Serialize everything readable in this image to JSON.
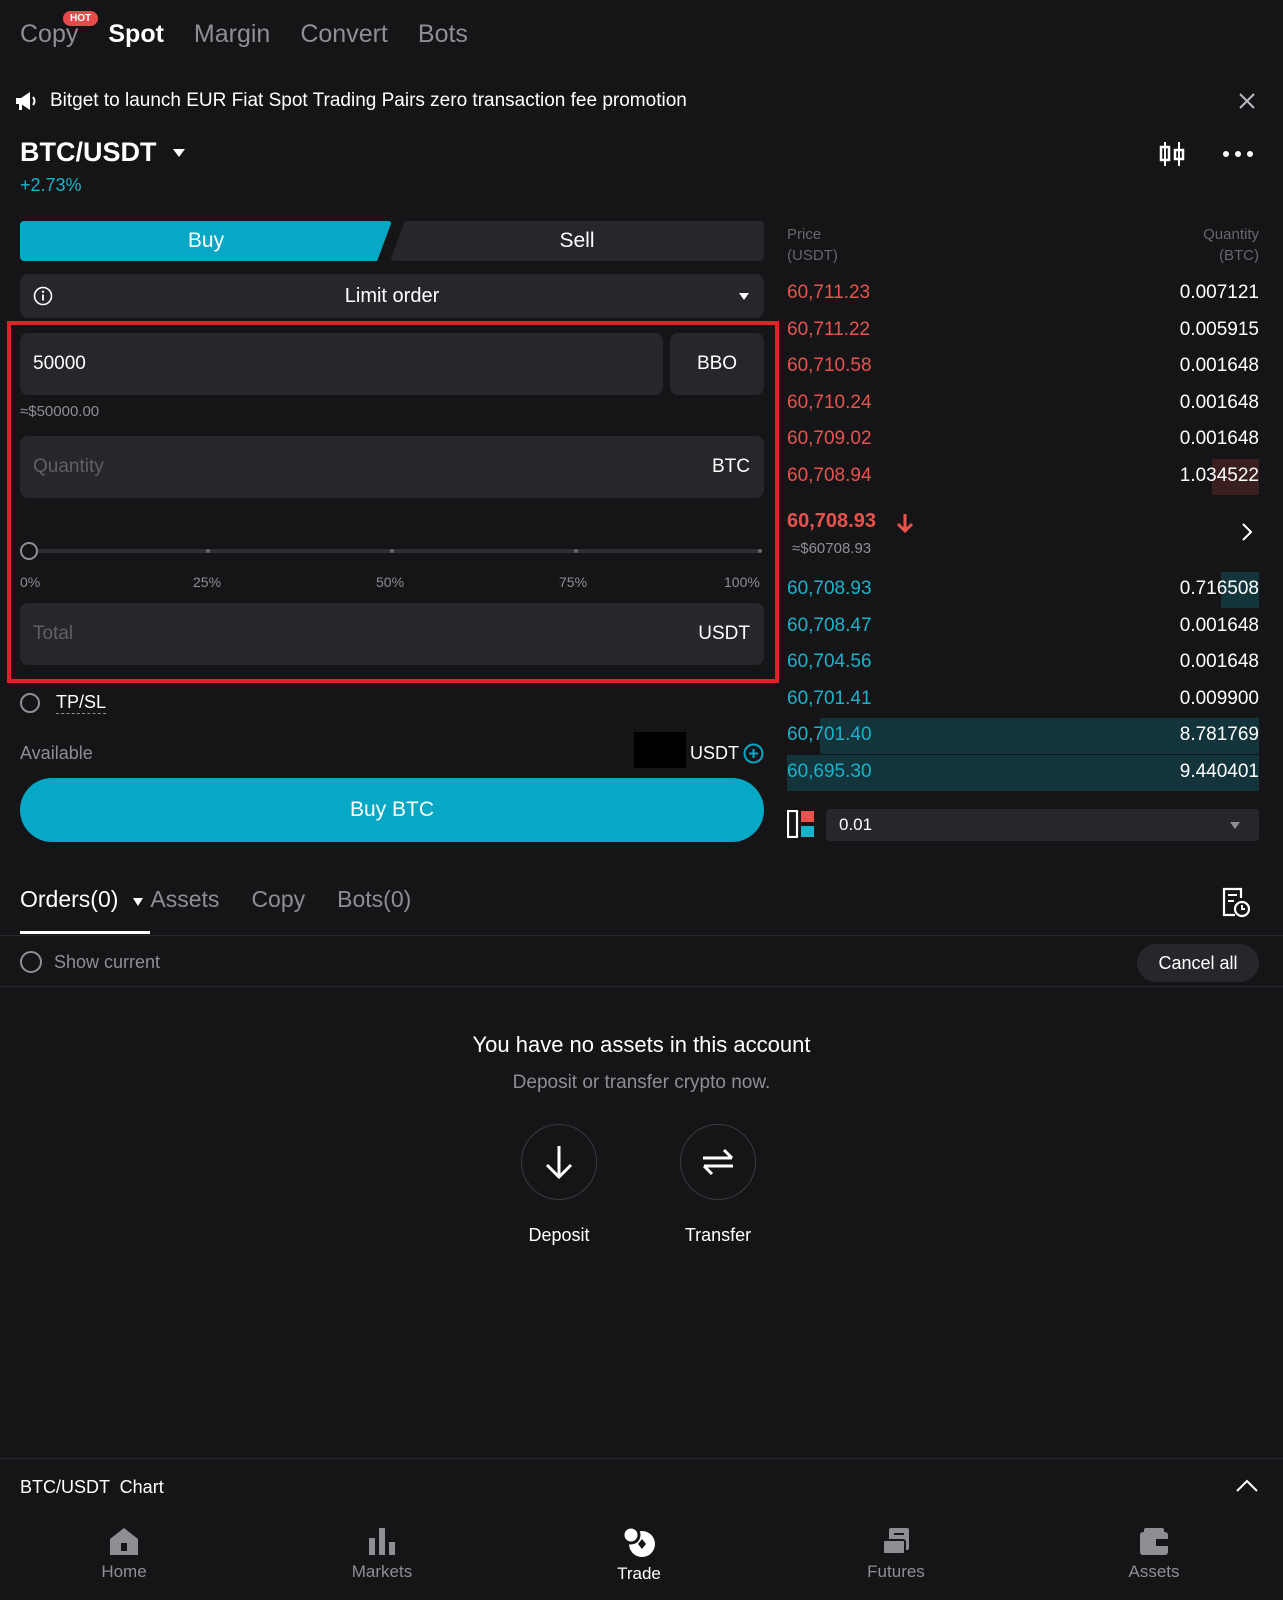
{
  "top_tabs": {
    "copy": "Copy",
    "hot_badge": "HOT",
    "spot": "Spot",
    "margin": "Margin",
    "convert": "Convert",
    "bots": "Bots"
  },
  "announcement": {
    "text": "Bitget to launch EUR Fiat Spot Trading Pairs zero transaction fee promotion"
  },
  "pair": {
    "symbol": "BTC/USDT",
    "change": "+2.73%"
  },
  "trade_form": {
    "buy_tab": "Buy",
    "sell_tab": "Sell",
    "order_type": "Limit order",
    "price_value": "50000",
    "bbo_label": "BBO",
    "price_approx": "≈$50000.00",
    "quantity_placeholder": "Quantity",
    "quantity_unit": "BTC",
    "slider_marks": [
      "0%",
      "25%",
      "50%",
      "75%",
      "100%"
    ],
    "slider_value_percent": 0,
    "total_placeholder": "Total",
    "total_unit": "USDT",
    "tpsl_label": "TP/SL",
    "available_label": "Available",
    "available_unit": "USDT",
    "buy_button": "Buy BTC"
  },
  "order_book": {
    "price_header": "Price",
    "price_unit": "(USDT)",
    "qty_header": "Quantity",
    "qty_unit": "(BTC)",
    "asks": [
      {
        "price": "60,711.23",
        "qty": "0.007121",
        "depth": 0.0
      },
      {
        "price": "60,711.22",
        "qty": "0.005915",
        "depth": 0.0
      },
      {
        "price": "60,710.58",
        "qty": "0.001648",
        "depth": 0.0
      },
      {
        "price": "60,710.24",
        "qty": "0.001648",
        "depth": 0.0
      },
      {
        "price": "60,709.02",
        "qty": "0.001648",
        "depth": 0.0
      },
      {
        "price": "60,708.94",
        "qty": "1.034522",
        "depth": 0.1
      }
    ],
    "mid_price": "60,708.93",
    "mid_price_usd": "≈$60708.93",
    "bids": [
      {
        "price": "60,708.93",
        "qty": "0.716508",
        "depth": 0.08
      },
      {
        "price": "60,708.47",
        "qty": "0.001648",
        "depth": 0.0
      },
      {
        "price": "60,704.56",
        "qty": "0.001648",
        "depth": 0.0
      },
      {
        "price": "60,701.41",
        "qty": "0.009900",
        "depth": 0.0
      },
      {
        "price": "60,701.40",
        "qty": "8.781769",
        "depth": 0.93
      },
      {
        "price": "60,695.30",
        "qty": "9.440401",
        "depth": 1.0
      }
    ],
    "precision": "0.01"
  },
  "orders_tabs": {
    "orders": "Orders(0)",
    "assets": "Assets",
    "copy": "Copy",
    "bots": "Bots(0)"
  },
  "orders_panel": {
    "show_current": "Show current",
    "cancel_all": "Cancel all",
    "empty_title": "You have no assets in this account",
    "empty_sub": "Deposit or transfer crypto now.",
    "deposit": "Deposit",
    "transfer": "Transfer"
  },
  "chart_bar": {
    "label": "BTC/USDT  Chart"
  },
  "bottom_nav": {
    "home": "Home",
    "markets": "Markets",
    "trade": "Trade",
    "futures": "Futures",
    "assets": "Assets"
  },
  "colors": {
    "accent": "#07a7c6",
    "ask": "#e8534d",
    "bid": "#1ab3cc",
    "background": "#151517",
    "highlight_box": "#e0222a"
  }
}
